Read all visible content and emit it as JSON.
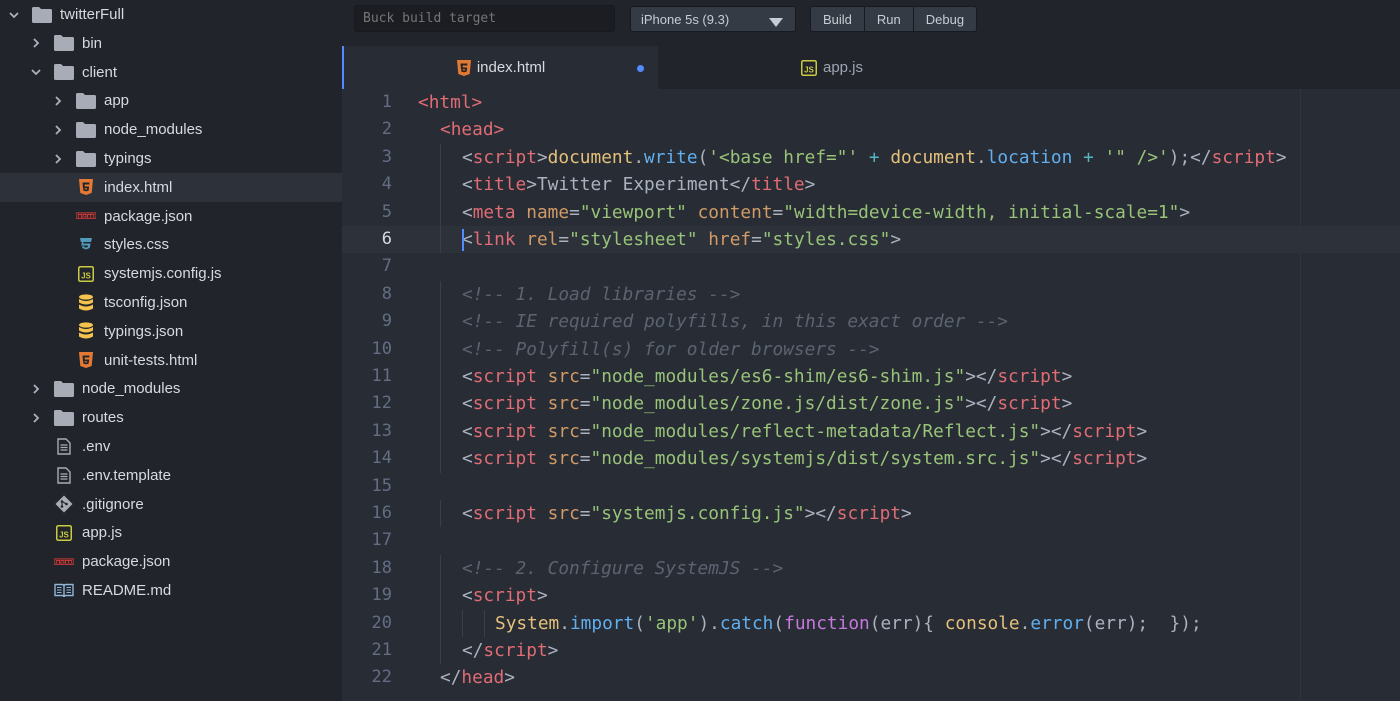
{
  "colors": {
    "folder": "#a7acb6",
    "html_icon": "#e37933",
    "npm_icon": "#cb3837",
    "css_icon": "#519aba",
    "js_icon": "#cbcb41",
    "json_icon": "#f5c34b",
    "accent": "#528bff"
  },
  "sidebar": {
    "items": [
      {
        "label": "twitterFull",
        "icon": "folder-icon",
        "chev": "down"
      },
      {
        "label": "bin",
        "icon": "folder-icon",
        "chev": "right"
      },
      {
        "label": "client",
        "icon": "folder-icon",
        "chev": "down"
      },
      {
        "label": "app",
        "icon": "folder-icon",
        "chev": "right"
      },
      {
        "label": "node_modules",
        "icon": "folder-icon",
        "chev": "right"
      },
      {
        "label": "typings",
        "icon": "folder-icon",
        "chev": "right"
      },
      {
        "label": "index.html",
        "icon": "html5-icon",
        "chev": "",
        "selected": true
      },
      {
        "label": "package.json",
        "icon": "npm-icon",
        "chev": ""
      },
      {
        "label": "styles.css",
        "icon": "css3-icon",
        "chev": ""
      },
      {
        "label": "systemjs.config.js",
        "icon": "js-file-icon",
        "chev": ""
      },
      {
        "label": "tsconfig.json",
        "icon": "database-icon",
        "chev": ""
      },
      {
        "label": "typings.json",
        "icon": "database-icon",
        "chev": ""
      },
      {
        "label": "unit-tests.html",
        "icon": "html5-icon",
        "chev": ""
      },
      {
        "label": "node_modules",
        "icon": "folder-icon",
        "chev": "right"
      },
      {
        "label": "routes",
        "icon": "folder-icon",
        "chev": "right"
      },
      {
        "label": ".env",
        "icon": "text-file-icon",
        "chev": ""
      },
      {
        "label": ".env.template",
        "icon": "text-file-icon",
        "chev": ""
      },
      {
        "label": ".gitignore",
        "icon": "git-icon",
        "chev": ""
      },
      {
        "label": "app.js",
        "icon": "js-file-icon",
        "chev": ""
      },
      {
        "label": "package.json",
        "icon": "npm-icon",
        "chev": ""
      },
      {
        "label": "README.md",
        "icon": "book-icon",
        "chev": ""
      }
    ]
  },
  "toolbar": {
    "build_target_placeholder": "Buck build target",
    "device": "iPhone 5s (9.3)",
    "build_label": "Build",
    "run_label": "Run",
    "debug_label": "Debug"
  },
  "tabs": [
    {
      "label": "index.html",
      "icon": "html5-icon",
      "active": true,
      "modified": true
    },
    {
      "label": "app.js",
      "icon": "js-file-icon",
      "active": false,
      "modified": false
    }
  ],
  "editor": {
    "cursor_line": 6,
    "lines": [
      {
        "n": "1",
        "t": [
          [
            "tag",
            "<html>"
          ]
        ]
      },
      {
        "n": "2",
        "t": [
          [
            "tag",
            "<head>"
          ]
        ]
      },
      {
        "n": "3",
        "t": [
          [
            "pun",
            "<"
          ],
          [
            "tag",
            "script"
          ],
          [
            "pun",
            ">"
          ],
          [
            "obj",
            "document"
          ],
          [
            "pun",
            "."
          ],
          [
            "fn",
            "write"
          ],
          [
            "pun",
            "("
          ],
          [
            "str",
            "'<base href=\"'"
          ],
          [
            "pun",
            " "
          ],
          [
            "op",
            "+"
          ],
          [
            "pun",
            " "
          ],
          [
            "obj",
            "document"
          ],
          [
            "pun",
            "."
          ],
          [
            "fn",
            "location"
          ],
          [
            "pun",
            " "
          ],
          [
            "op",
            "+"
          ],
          [
            "pun",
            " "
          ],
          [
            "str",
            "'\" />'"
          ],
          [
            "pun",
            ");</"
          ],
          [
            "tag",
            "script"
          ],
          [
            "pun",
            ">"
          ]
        ]
      },
      {
        "n": "4",
        "t": [
          [
            "pun",
            "<"
          ],
          [
            "tag",
            "title"
          ],
          [
            "pun",
            ">"
          ],
          [
            "txt",
            "Twitter Experiment"
          ],
          [
            "pun",
            "</"
          ],
          [
            "tag",
            "title"
          ],
          [
            "pun",
            ">"
          ]
        ]
      },
      {
        "n": "5",
        "t": [
          [
            "pun",
            "<"
          ],
          [
            "tag",
            "meta"
          ],
          [
            "pun",
            " "
          ],
          [
            "attr",
            "name"
          ],
          [
            "pun",
            "="
          ],
          [
            "str",
            "\"viewport\""
          ],
          [
            "pun",
            " "
          ],
          [
            "attr",
            "content"
          ],
          [
            "pun",
            "="
          ],
          [
            "str",
            "\"width=device-width, initial-scale=1\""
          ],
          [
            "pun",
            ">"
          ]
        ]
      },
      {
        "n": "6",
        "t": [
          [
            "pun",
            "<"
          ],
          [
            "tag",
            "link"
          ],
          [
            "pun",
            " "
          ],
          [
            "attr",
            "rel"
          ],
          [
            "pun",
            "="
          ],
          [
            "str",
            "\"stylesheet\""
          ],
          [
            "pun",
            " "
          ],
          [
            "attr",
            "href"
          ],
          [
            "pun",
            "="
          ],
          [
            "str",
            "\"styles.css\""
          ],
          [
            "pun",
            ">"
          ]
        ]
      },
      {
        "n": "7",
        "t": []
      },
      {
        "n": "8",
        "t": [
          [
            "com",
            "<!-- 1. Load libraries -->"
          ]
        ]
      },
      {
        "n": "9",
        "t": [
          [
            "com",
            "<!-- IE required polyfills, in this exact order -->"
          ]
        ]
      },
      {
        "n": "10",
        "t": [
          [
            "com",
            "<!-- Polyfill(s) for older browsers -->"
          ]
        ]
      },
      {
        "n": "11",
        "t": [
          [
            "pun",
            "<"
          ],
          [
            "tag",
            "script"
          ],
          [
            "pun",
            " "
          ],
          [
            "attr",
            "src"
          ],
          [
            "pun",
            "="
          ],
          [
            "str",
            "\"node_modules/es6-shim/es6-shim.js\""
          ],
          [
            "pun",
            "></"
          ],
          [
            "tag",
            "script"
          ],
          [
            "pun",
            ">"
          ]
        ]
      },
      {
        "n": "12",
        "t": [
          [
            "pun",
            "<"
          ],
          [
            "tag",
            "script"
          ],
          [
            "pun",
            " "
          ],
          [
            "attr",
            "src"
          ],
          [
            "pun",
            "="
          ],
          [
            "str",
            "\"node_modules/zone.js/dist/zone.js\""
          ],
          [
            "pun",
            "></"
          ],
          [
            "tag",
            "script"
          ],
          [
            "pun",
            ">"
          ]
        ]
      },
      {
        "n": "13",
        "t": [
          [
            "pun",
            "<"
          ],
          [
            "tag",
            "script"
          ],
          [
            "pun",
            " "
          ],
          [
            "attr",
            "src"
          ],
          [
            "pun",
            "="
          ],
          [
            "str",
            "\"node_modules/reflect-metadata/Reflect.js\""
          ],
          [
            "pun",
            "></"
          ],
          [
            "tag",
            "script"
          ],
          [
            "pun",
            ">"
          ]
        ]
      },
      {
        "n": "14",
        "t": [
          [
            "pun",
            "<"
          ],
          [
            "tag",
            "script"
          ],
          [
            "pun",
            " "
          ],
          [
            "attr",
            "src"
          ],
          [
            "pun",
            "="
          ],
          [
            "str",
            "\"node_modules/systemjs/dist/system.src.js\""
          ],
          [
            "pun",
            "></"
          ],
          [
            "tag",
            "script"
          ],
          [
            "pun",
            ">"
          ]
        ]
      },
      {
        "n": "15",
        "t": []
      },
      {
        "n": "16",
        "t": [
          [
            "pun",
            "<"
          ],
          [
            "tag",
            "script"
          ],
          [
            "pun",
            " "
          ],
          [
            "attr",
            "src"
          ],
          [
            "pun",
            "="
          ],
          [
            "str",
            "\"systemjs.config.js\""
          ],
          [
            "pun",
            "></"
          ],
          [
            "tag",
            "script"
          ],
          [
            "pun",
            ">"
          ]
        ]
      },
      {
        "n": "17",
        "t": []
      },
      {
        "n": "18",
        "t": [
          [
            "com",
            "<!-- 2. Configure SystemJS -->"
          ]
        ]
      },
      {
        "n": "19",
        "t": [
          [
            "pun",
            "<"
          ],
          [
            "tag",
            "script"
          ],
          [
            "pun",
            ">"
          ]
        ]
      },
      {
        "n": "20",
        "t": [
          [
            "obj",
            "System"
          ],
          [
            "pun",
            "."
          ],
          [
            "fn",
            "import"
          ],
          [
            "pun",
            "("
          ],
          [
            "str",
            "'app'"
          ],
          [
            "pun",
            ")."
          ],
          [
            "fn",
            "catch"
          ],
          [
            "pun",
            "("
          ],
          [
            "kw",
            "function"
          ],
          [
            "pun",
            "(err){ "
          ],
          [
            "obj",
            "console"
          ],
          [
            "pun",
            "."
          ],
          [
            "fn",
            "error"
          ],
          [
            "pun",
            "(err);  });"
          ]
        ]
      },
      {
        "n": "21",
        "t": [
          [
            "pun",
            "</"
          ],
          [
            "tag",
            "script"
          ],
          [
            "pun",
            ">"
          ]
        ]
      },
      {
        "n": "22",
        "t": [
          [
            "pun",
            "</"
          ],
          [
            "tag",
            "head"
          ],
          [
            "pun",
            ">"
          ]
        ]
      }
    ]
  }
}
